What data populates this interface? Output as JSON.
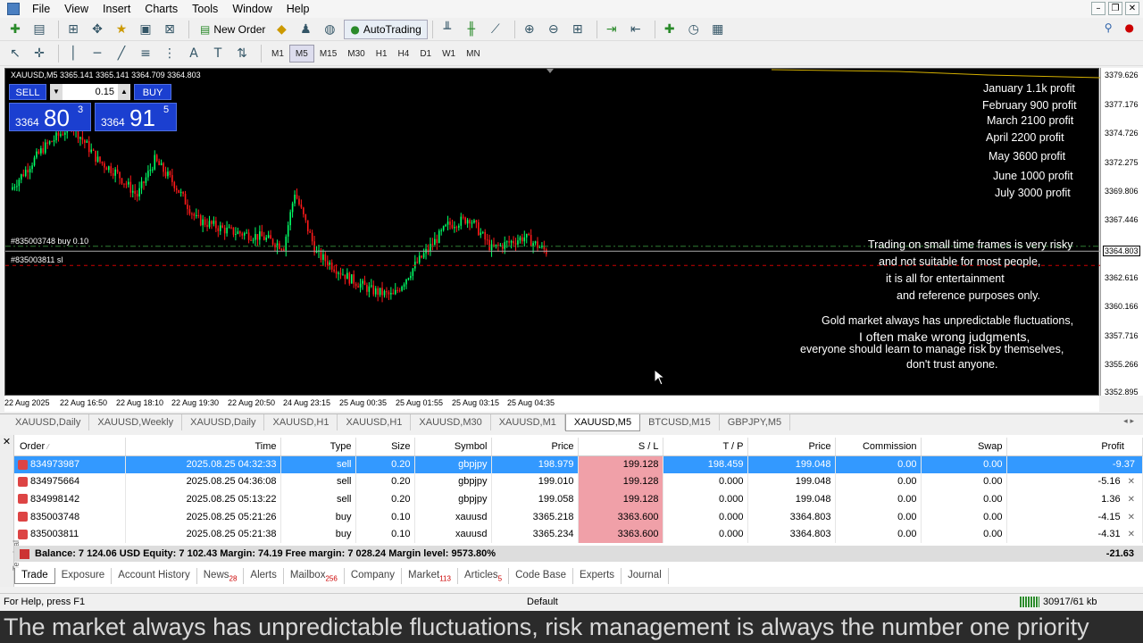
{
  "menu": [
    "File",
    "View",
    "Insert",
    "Charts",
    "Tools",
    "Window",
    "Help"
  ],
  "toolbar": {
    "new_order": "New Order",
    "autotrading": "AutoTrading"
  },
  "timeframes": [
    "M1",
    "M5",
    "M15",
    "M30",
    "H1",
    "H4",
    "D1",
    "W1",
    "MN"
  ],
  "active_timeframe": "M5",
  "chart": {
    "info": "XAUUSD,M5  3365.141 3365.141 3364.709 3364.803",
    "trade_panel": {
      "sell": "SELL",
      "buy": "BUY",
      "lot": "0.15",
      "sell_small": "3364",
      "sell_big": "80",
      "sell_sup": "3",
      "buy_small": "3364",
      "buy_big": "91",
      "buy_sup": "5"
    },
    "order_label_1": "#835003748 buy 0.10",
    "order_label_2": "#835003811 sl",
    "profits": [
      "January 1.1k profit",
      "February 900 profit",
      "March 2100 profit",
      "April 2200 profit",
      "May 3600  profit",
      "June 1000 profit",
      "July 3000 profit"
    ],
    "warnings": [
      "Trading on small time frames is very risky",
      "and not suitable for most people,",
      "it is all for entertainment",
      "and reference purposes only.",
      "Gold market always has unpredictable fluctuations,",
      "I often make wrong judgments,",
      "everyone should learn to manage risk by themselves,",
      "don't trust anyone."
    ],
    "price_labels": [
      "3379.626",
      "3377.176",
      "3374.726",
      "3372.275",
      "3369.806",
      "3367.446",
      "3364.803",
      "3362.616",
      "3360.166",
      "3357.716",
      "3355.266",
      "3352.895"
    ],
    "time_labels": [
      "22 Aug 2025",
      "22 Aug 16:50",
      "22 Aug 18:10",
      "22 Aug 19:30",
      "22 Aug 20:50",
      "24 Aug 23:15",
      "25 Aug 00:35",
      "25 Aug 01:55",
      "25 Aug 03:15",
      "25 Aug 04:35"
    ]
  },
  "chart_tabs": [
    "XAUUSD,Daily",
    "XAUUSD,Weekly",
    "XAUUSD,Daily",
    "XAUUSD,H1",
    "XAUUSD,H1",
    "XAUUSD,M30",
    "XAUUSD,M1",
    "XAUUSD,M5",
    "BTCUSD,M15",
    "GBPJPY,M5"
  ],
  "active_chart_tab": "XAUUSD,M5",
  "table": {
    "headers": [
      "Order",
      "Time",
      "Type",
      "Size",
      "Symbol",
      "Price",
      "S / L",
      "T / P",
      "Price",
      "Commission",
      "Swap",
      "Profit"
    ],
    "rows": [
      [
        "834973987",
        "2025.08.25 04:32:33",
        "sell",
        "0.20",
        "gbpjpy",
        "198.979",
        "199.128",
        "198.459",
        "199.048",
        "0.00",
        "0.00",
        "-9.37"
      ],
      [
        "834975664",
        "2025.08.25 04:36:08",
        "sell",
        "0.20",
        "gbpjpy",
        "199.010",
        "199.128",
        "0.000",
        "199.048",
        "0.00",
        "0.00",
        "-5.16"
      ],
      [
        "834998142",
        "2025.08.25 05:13:22",
        "sell",
        "0.20",
        "gbpjpy",
        "199.058",
        "199.128",
        "0.000",
        "199.048",
        "0.00",
        "0.00",
        "1.36"
      ],
      [
        "835003748",
        "2025.08.25 05:21:26",
        "buy",
        "0.10",
        "xauusd",
        "3365.218",
        "3363.600",
        "0.000",
        "3364.803",
        "0.00",
        "0.00",
        "-4.15"
      ],
      [
        "835003811",
        "2025.08.25 05:21:38",
        "buy",
        "0.10",
        "xauusd",
        "3365.234",
        "3363.600",
        "0.000",
        "3364.803",
        "0.00",
        "0.00",
        "-4.31"
      ]
    ],
    "balance": "Balance: 7 124.06 USD  Equity: 7 102.43  Margin: 74.19  Free margin: 7 028.24  Margin level: 9573.80%",
    "total": "-21.63"
  },
  "bottom_tabs": [
    {
      "label": "Trade",
      "badge": ""
    },
    {
      "label": "Exposure",
      "badge": ""
    },
    {
      "label": "Account History",
      "badge": ""
    },
    {
      "label": "News",
      "badge": "28"
    },
    {
      "label": "Alerts",
      "badge": ""
    },
    {
      "label": "Mailbox",
      "badge": "256"
    },
    {
      "label": "Company",
      "badge": ""
    },
    {
      "label": "Market",
      "badge": "113"
    },
    {
      "label": "Articles",
      "badge": "5"
    },
    {
      "label": "Code Base",
      "badge": ""
    },
    {
      "label": "Experts",
      "badge": ""
    },
    {
      "label": "Journal",
      "badge": ""
    }
  ],
  "terminal_label": "Terminal",
  "status": {
    "help": "For Help, press F1",
    "profile": "Default",
    "traffic": "30917/61 kb"
  },
  "caption": "The market always has unpredictable fluctuations, risk management is always the number one priority",
  "colors": {
    "chart_bg": "#000000",
    "bull": "#00ff66",
    "bear": "#ff1a1a",
    "panel": "#1b3fd0",
    "selected": "#3399ff",
    "sl": "#f0a0a8"
  }
}
